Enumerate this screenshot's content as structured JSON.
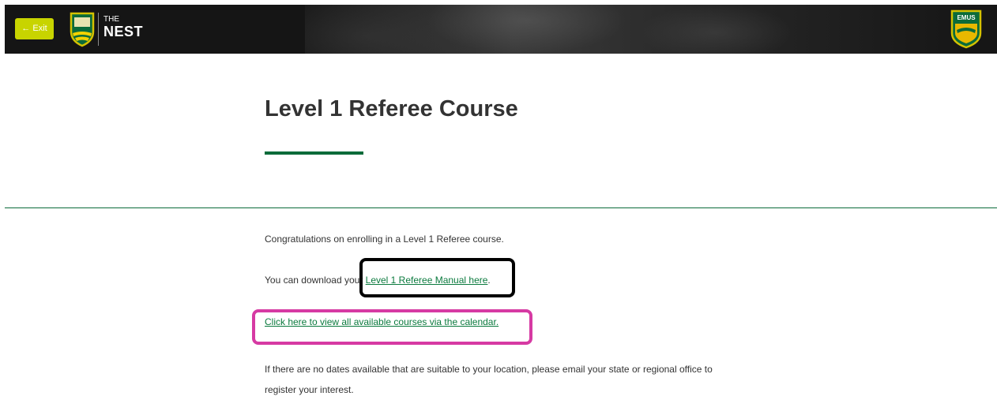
{
  "header": {
    "exit_label": "← Exit",
    "logo_the": "THE",
    "logo_nest": "NEST",
    "emus_label": "EMUS",
    "colors": {
      "bar": "#151515",
      "exit": "#c8d400",
      "accent": "#0b6b3a"
    }
  },
  "main": {
    "title": "Level 1 Referee Course",
    "intro": "Congratulations on enrolling in a Level 1 Referee course.",
    "download_prefix": "You can download your ",
    "manual_link": "Level 1 Referee Manual here",
    "download_suffix": ".",
    "calendar_link": "Click here to view all available courses via the calendar.",
    "note": "If there are no dates available that are suitable to your location, please email your state or regional office to register your interest."
  }
}
